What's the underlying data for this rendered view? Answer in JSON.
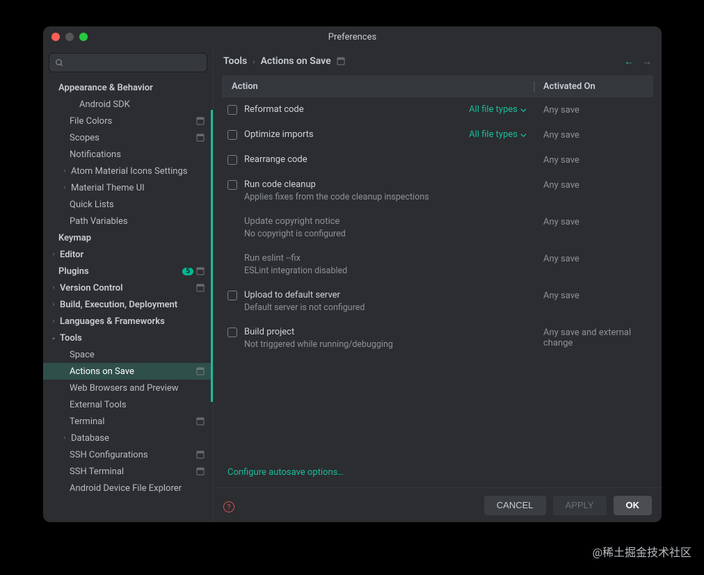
{
  "window": {
    "title": "Preferences"
  },
  "search": {
    "placeholder": ""
  },
  "sidebar": {
    "items": [
      {
        "label": "Appearance & Behavior",
        "indent": 22,
        "bold": true
      },
      {
        "label": "Android SDK",
        "indent": 52
      },
      {
        "label": "File Colors",
        "indent": 38,
        "proj": true
      },
      {
        "label": "Scopes",
        "indent": 38,
        "proj": true
      },
      {
        "label": "Notifications",
        "indent": 38
      },
      {
        "label": "Atom Material Icons Settings",
        "indent": 38,
        "chev": ">"
      },
      {
        "label": "Material Theme UI",
        "indent": 38,
        "chev": ">"
      },
      {
        "label": "Quick Lists",
        "indent": 38
      },
      {
        "label": "Path Variables",
        "indent": 38
      },
      {
        "label": "Keymap",
        "indent": 22,
        "bold": true
      },
      {
        "label": "Editor",
        "indent": 22,
        "bold": true,
        "chev": ">"
      },
      {
        "label": "Plugins",
        "indent": 22,
        "bold": true,
        "badge": "5",
        "proj": true
      },
      {
        "label": "Version Control",
        "indent": 22,
        "bold": true,
        "chev": ">",
        "proj": true
      },
      {
        "label": "Build, Execution, Deployment",
        "indent": 22,
        "bold": true,
        "chev": ">"
      },
      {
        "label": "Languages & Frameworks",
        "indent": 22,
        "bold": true,
        "chev": ">"
      },
      {
        "label": "Tools",
        "indent": 22,
        "bold": true,
        "chev": "v"
      },
      {
        "label": "Space",
        "indent": 38
      },
      {
        "label": "Actions on Save",
        "indent": 38,
        "sel": true,
        "proj": true
      },
      {
        "label": "Web Browsers and Preview",
        "indent": 38
      },
      {
        "label": "External Tools",
        "indent": 38
      },
      {
        "label": "Terminal",
        "indent": 38,
        "proj": true
      },
      {
        "label": "Database",
        "indent": 38,
        "chev": ">"
      },
      {
        "label": "SSH Configurations",
        "indent": 38,
        "proj": true
      },
      {
        "label": "SSH Terminal",
        "indent": 38,
        "proj": true
      },
      {
        "label": "Android Device File Explorer",
        "indent": 38
      }
    ]
  },
  "crumbs": {
    "a": "Tools",
    "b": "Actions on Save"
  },
  "table": {
    "head_action": "Action",
    "head_activated": "Activated On"
  },
  "rows": [
    {
      "chk": true,
      "name": "Reformat code",
      "filetypes": "All file types",
      "activated": "Any save"
    },
    {
      "chk": true,
      "name": "Optimize imports",
      "filetypes": "All file types",
      "activated": "Any save"
    },
    {
      "chk": true,
      "name": "Rearrange code",
      "activated": "Any save"
    },
    {
      "chk": true,
      "name": "Run code cleanup",
      "desc": "Applies fixes from the code cleanup inspections",
      "activated": "Any save"
    },
    {
      "chk": false,
      "name": "Update copyright notice",
      "desc": "No copyright is configured",
      "activated": "Any save",
      "dim": true
    },
    {
      "chk": false,
      "name": "Run eslint --fix",
      "desc": "ESLint integration disabled",
      "activated": "Any save",
      "dim": true
    },
    {
      "chk": true,
      "name": "Upload to default server",
      "desc": "Default server is not configured",
      "activated": "Any save"
    },
    {
      "chk": true,
      "name": "Build project",
      "desc": "Not triggered while running/debugging",
      "activated": "Any save and external change"
    }
  ],
  "link": {
    "text": "Configure autosave options…"
  },
  "buttons": {
    "cancel": "CANCEL",
    "apply": "APPLY",
    "ok": "OK"
  },
  "watermark": "@稀土掘金技术社区"
}
